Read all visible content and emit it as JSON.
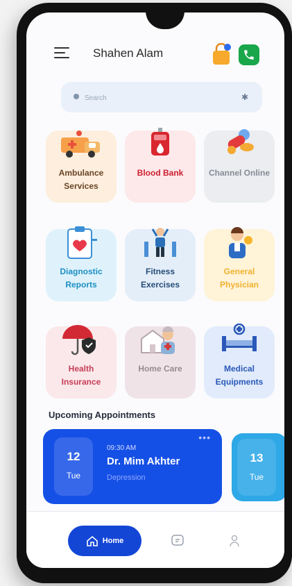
{
  "header": {
    "user_name": "Shahen Alam",
    "icons": [
      "menu-icon",
      "shopping-bag-icon",
      "phone-call-icon"
    ],
    "bag_badge_color": "#2d6cf0"
  },
  "search": {
    "placeholder": "Search"
  },
  "services": [
    {
      "label": "Ambulance Services",
      "icon": "ambulance-icon",
      "bg": "#fdeedd",
      "color": "#6b4426"
    },
    {
      "label": "Blood Bank",
      "icon": "blood-bag-icon",
      "bg": "#fde8ea",
      "color": "#cc1f2e"
    },
    {
      "label": "Channel Online",
      "icon": "pills-icon",
      "bg": "#ebedf0",
      "color": "#878c96"
    },
    {
      "label": "Diagnostic Reports",
      "icon": "medical-report-icon",
      "bg": "#dff2fb",
      "color": "#1d8fc4"
    },
    {
      "label": "Fitness Exercises",
      "icon": "fitness-icon",
      "bg": "#e4eef9",
      "color": "#254d77"
    },
    {
      "label": "General Physician",
      "icon": "doctor-icon",
      "bg": "#fff3d8",
      "color": "#f0b22f"
    },
    {
      "label": "Health Insurance",
      "icon": "insurance-umbrella-icon",
      "bg": "#fbe8ea",
      "color": "#c63e58"
    },
    {
      "label": "Home Care",
      "icon": "home-care-icon",
      "bg": "#efe3e7",
      "color": "#9b8991"
    },
    {
      "label": "Medical Equipments",
      "icon": "hospital-bed-icon",
      "bg": "#e1ebfb",
      "color": "#2a58b8"
    }
  ],
  "appointments": {
    "title": "Upcoming Appointments",
    "items": [
      {
        "day": "12",
        "weekday": "Tue",
        "time": "09:30 AM",
        "doctor": "Dr. Mim Akhter",
        "specialty": "Depression",
        "more": "•••"
      },
      {
        "day": "13",
        "weekday": "Tue"
      }
    ]
  },
  "nav": {
    "home_label": "Home",
    "icons": [
      "home-icon",
      "chat-icon",
      "profile-icon"
    ]
  },
  "colors": {
    "primary": "#1446d6",
    "appointment_card": "#1550e6",
    "appointment_card_2": "#2ea8e6",
    "call_green": "#1aa64a"
  }
}
